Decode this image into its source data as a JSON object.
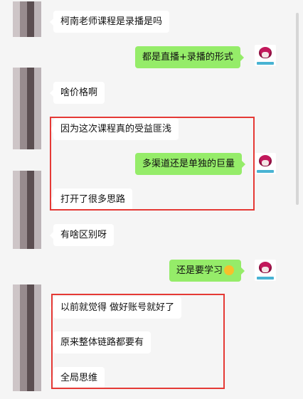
{
  "messages": [
    {
      "side": "left",
      "text": "柯南老师课程是录播是吗"
    },
    {
      "side": "right",
      "text": "都是直播+录播的形式"
    },
    {
      "side": "left",
      "text": "啥价格啊"
    },
    {
      "side": "left",
      "text": "因为这次课程真的受益匪浅"
    },
    {
      "side": "right",
      "text": "多渠道还是单独的巨量"
    },
    {
      "side": "left",
      "text": "打开了很多思路"
    },
    {
      "side": "left",
      "text": "有啥区别呀"
    },
    {
      "side": "right",
      "text": "还是要学习",
      "emoji": "smiling-face-emoji"
    },
    {
      "side": "left",
      "text": "以前就觉得 做好账号就好了"
    },
    {
      "side": "left",
      "text": "原来整体链路都要有"
    },
    {
      "side": "left",
      "text": "全局思维"
    }
  ],
  "colors": {
    "background": "#f5f5f5",
    "left_bubble": "#ffffff",
    "right_bubble": "#95ec69",
    "highlight_box": "#e53935"
  }
}
